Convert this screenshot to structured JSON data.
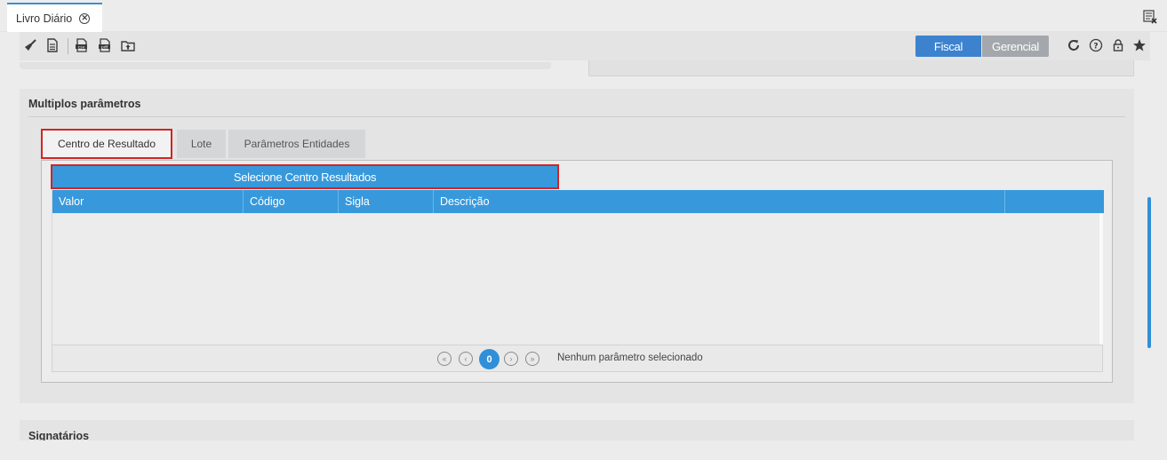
{
  "tab": {
    "title": "Livro Diário",
    "close_icon": "close-circle-icon"
  },
  "toolbar": {
    "icons": [
      "broom-clean-icon",
      "document-icon",
      "export-csv-icon",
      "export-pdf-icon",
      "upload-folder-icon"
    ],
    "fiscal_label": "Fiscal",
    "gerencial_label": "Gerencial",
    "right_icons": [
      "refresh-icon",
      "help-icon",
      "lock-icon",
      "star-icon"
    ]
  },
  "section": {
    "title": "Multiplos parâmetros",
    "tabs": [
      {
        "label": "Centro de Resultado",
        "active": true
      },
      {
        "label": "Lote",
        "active": false
      },
      {
        "label": "Parâmetros Entidades",
        "active": false
      }
    ],
    "select_button": "Selecione Centro Resultados",
    "columns": [
      "Valor",
      "Código",
      "Sigla",
      "Descrição",
      ""
    ],
    "rows": [],
    "pager": {
      "page": "0",
      "status": "Nenhum parâmetro selecionado"
    }
  },
  "section2": {
    "title": "Signatários"
  },
  "colors": {
    "accent": "#3799dc",
    "fiscal": "#3d82cf",
    "gerencial": "#a4a8ad",
    "highlight": "#d32424"
  }
}
